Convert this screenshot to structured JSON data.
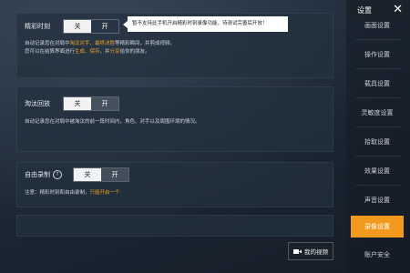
{
  "panels": {
    "highlight": {
      "label": "精彩时刻",
      "off": "关",
      "on": "开",
      "desc_lines": [
        {
          "pre": "自动记录您在对局中",
          "hl1": "淘汰对手、最终决胜",
          "post": "等精彩瞬间，并剪成视频。"
        },
        {
          "pre": "您可以在结算界面进行",
          "hl1": "生成、保存",
          "post": "，并",
          "hl2": "分享",
          "post2": "给你的朋友。"
        }
      ],
      "tooltip": "暂不支持此手机开启精彩时刻录像功能，待测试完善后开放！"
    },
    "elimination": {
      "label": "淘汰回放",
      "off": "关",
      "on": "开",
      "desc": "自动记录您在对局中被淘汰的前一段时间内，角色、对手以及周围环境的情况。"
    },
    "free": {
      "label": "自由录制",
      "help": "?",
      "off": "关",
      "on": "开",
      "note_pre": "注意：精彩时刻和自由录制，",
      "note_hl": "只能开启一个"
    }
  },
  "video_button": {
    "label": "我的视频",
    "icon": "camera-icon"
  },
  "sidebar": {
    "title": "设置",
    "close": "✕",
    "items": [
      {
        "label": "画面设置"
      },
      {
        "label": "操作设置"
      },
      {
        "label": "载具设置"
      },
      {
        "label": "灵敏度设置"
      },
      {
        "label": "拾取设置"
      },
      {
        "label": "效果设置"
      },
      {
        "label": "声音设置"
      },
      {
        "label": "录像设置"
      },
      {
        "label": "账户安全"
      }
    ],
    "active_index": 7,
    "accent": "#f39a1e"
  }
}
